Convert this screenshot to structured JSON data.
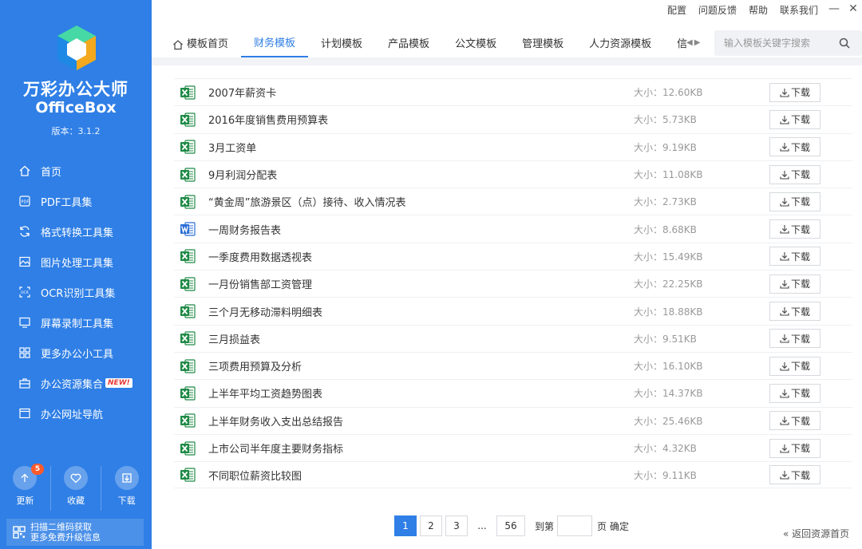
{
  "app": {
    "name_cn": "万彩办公大师",
    "name_en": "OfficeBox",
    "version": "版本：3.1.2"
  },
  "topmenu": [
    "配置",
    "问题反馈",
    "帮助",
    "联系我们"
  ],
  "sidebar": {
    "items": [
      {
        "label": "首页",
        "icon": "home-icon"
      },
      {
        "label": "PDF工具集",
        "icon": "pdf-icon"
      },
      {
        "label": "格式转换工具集",
        "icon": "convert-icon"
      },
      {
        "label": "图片处理工具集",
        "icon": "image-icon"
      },
      {
        "label": "OCR识别工具集",
        "icon": "ocr-icon"
      },
      {
        "label": "屏幕录制工具集",
        "icon": "screen-icon"
      },
      {
        "label": "更多办公小工具",
        "icon": "apps-icon"
      },
      {
        "label": "办公资源集合",
        "icon": "briefcase-icon",
        "badge": "NEW!"
      },
      {
        "label": "办公网址导航",
        "icon": "browser-icon"
      }
    ],
    "bottom": [
      {
        "label": "更新",
        "icon": "update-icon",
        "count": "5"
      },
      {
        "label": "收藏",
        "icon": "heart-icon"
      },
      {
        "label": "下载",
        "icon": "download-icon"
      }
    ],
    "qr_line1": "扫描二维码获取",
    "qr_line2": "更多免费升级信息"
  },
  "tabs": [
    {
      "label": "模板首页"
    },
    {
      "label": "财务模板",
      "active": true
    },
    {
      "label": "计划模板"
    },
    {
      "label": "产品模板"
    },
    {
      "label": "公文模板"
    },
    {
      "label": "管理模板"
    },
    {
      "label": "人力资源模板"
    },
    {
      "label": "信"
    }
  ],
  "search": {
    "placeholder": "输入模板关键字搜索"
  },
  "files": [
    {
      "name": "2007年薪资卡",
      "type": "xls",
      "size": "大小：12.60KB"
    },
    {
      "name": "2016年度销售费用预算表",
      "type": "xls",
      "size": "大小：5.73KB"
    },
    {
      "name": "3月工资单",
      "type": "xls",
      "size": "大小：9.19KB"
    },
    {
      "name": "9月利润分配表",
      "type": "xls",
      "size": "大小：11.08KB"
    },
    {
      "name": "“黄金周”旅游景区（点）接待、收入情况表",
      "type": "xls",
      "size": "大小：2.73KB"
    },
    {
      "name": "一周财务报告表",
      "type": "doc",
      "size": "大小：8.68KB"
    },
    {
      "name": "一季度费用数据透视表",
      "type": "xls",
      "size": "大小：15.49KB"
    },
    {
      "name": "一月份销售部工资管理",
      "type": "xls",
      "size": "大小：22.25KB"
    },
    {
      "name": "三个月无移动滞料明细表",
      "type": "xls",
      "size": "大小：18.88KB"
    },
    {
      "name": "三月损益表",
      "type": "xls",
      "size": "大小：9.51KB"
    },
    {
      "name": "三项费用预算及分析",
      "type": "xls",
      "size": "大小：16.10KB"
    },
    {
      "name": "上半年平均工资趋势图表",
      "type": "xls",
      "size": "大小：14.37KB"
    },
    {
      "name": "上半年财务收入支出总结报告",
      "type": "xls",
      "size": "大小：25.46KB"
    },
    {
      "name": "上市公司半年度主要财务指标",
      "type": "xls",
      "size": "大小：4.32KB"
    },
    {
      "name": "不同职位薪资比较图",
      "type": "xls",
      "size": "大小：9.11KB"
    }
  ],
  "download_label": "下载",
  "pagination": {
    "pages": [
      "1",
      "2",
      "3"
    ],
    "ellipsis": "...",
    "last": "56",
    "goto_prefix": "到第",
    "goto_suffix": "页",
    "confirm": "确定"
  },
  "back_link": "« 返回资源首页",
  "colors": {
    "primary": "#2f7fe6",
    "excel": "#1f8a46",
    "word": "#2b6fd6"
  }
}
